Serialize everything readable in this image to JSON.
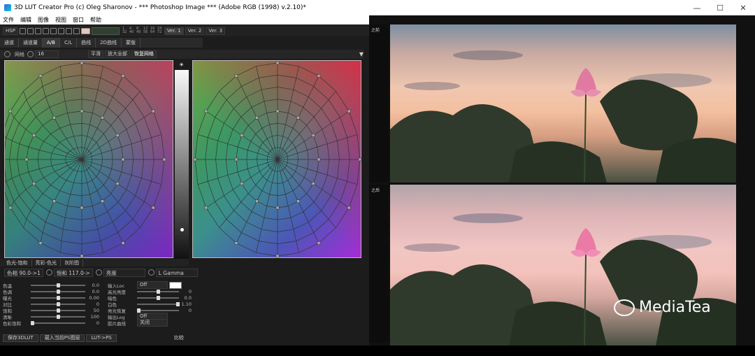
{
  "window": {
    "title": "3D LUT Creator Pro (c) Oleg Sharonov - *** Photoshop Image *** (Adobe RGB (1998) v.2.10)*",
    "controls": [
      "—",
      "☐",
      "✕"
    ]
  },
  "menu": [
    "文件",
    "编辑",
    "图像",
    "视图",
    "窗口",
    "帮助"
  ],
  "toolbar": {
    "mode": "HSP",
    "versions": [
      "Ver. 1",
      "Ver. 2",
      "Ver. 3"
    ],
    "num_grid": [
      "1",
      "4",
      "8",
      "12",
      "16",
      "24",
      "32",
      "40",
      "48",
      "56",
      "64",
      "72"
    ]
  },
  "tabs": [
    "通道",
    "通道量",
    "A/B",
    "C/L",
    "曲线",
    "2D曲线",
    "蒙版"
  ],
  "options": {
    "grid_label": "网格",
    "grid_value": "16",
    "buttons": [
      "平滑",
      "放大全部",
      "恢复网格"
    ]
  },
  "below_tabs": [
    "色光-饱和",
    "亮彩-色光",
    "灰阶图"
  ],
  "readouts": {
    "hue": "色相 90.0->1",
    "saturation": "饱和 117.0->",
    "brightness": "亮度",
    "gamma": "L Gamma"
  },
  "params_left": [
    {
      "label": "色温",
      "value": "0.0",
      "pos": 0.5
    },
    {
      "label": "色调",
      "value": "0.0",
      "pos": 0.5
    },
    {
      "label": "曝光",
      "value": "0.00",
      "pos": 0.5
    },
    {
      "label": "对比",
      "value": "0",
      "pos": 0.5
    },
    {
      "label": "饱和",
      "value": "50",
      "pos": 0.5
    },
    {
      "label": "清晰",
      "value": "100",
      "pos": 0.5
    },
    {
      "label": "色彩饱和",
      "value": "0",
      "pos": 0.0
    }
  ],
  "params_right": [
    {
      "label": "输入Loc",
      "value": "Off"
    },
    {
      "label": "高光亮度",
      "value": "0"
    },
    {
      "label": "暗色",
      "value": "0.0"
    },
    {
      "label": "白色",
      "value": "1.10"
    },
    {
      "label": "亮光恢复",
      "value": "0"
    },
    {
      "label": "输出Log",
      "value": "Off"
    },
    {
      "label": "胶片曲线",
      "value": "关闭"
    }
  ],
  "bottom_buttons": [
    "保存3DLUT",
    "载入当前PS图层",
    "LUT->PS",
    "比较"
  ],
  "compare": {
    "before_label": "之前",
    "after_label": "之后"
  },
  "watermark": "MediaTea"
}
